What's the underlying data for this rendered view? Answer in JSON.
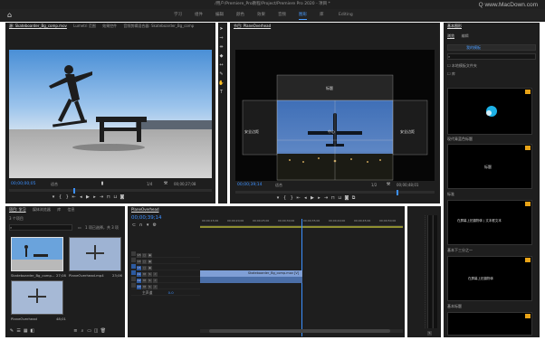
{
  "window_title": "/用户/Premiere_Pro教程/Project/Premiere Pro 2020 - 项目 *",
  "watermark": "Q www.MacDown.com",
  "menu": [
    "学习",
    "组件",
    "编辑",
    "颜色",
    "效果",
    "音频",
    "图形",
    "库",
    "Editing"
  ],
  "menu_active_index": 6,
  "source_tabs": [
    "源: Skateboarder_Bg_comp.mov",
    "Lumetri 范围",
    "效果控件",
    "音频剪辑混合器: Skateboarder_Bg_comp"
  ],
  "source_timecode_left": "00;00;00;05",
  "source_fit": "适合",
  "source_ratio": "1/4",
  "source_timecode_right": "00;00;27;08",
  "program_tab": "节目: PlaneOverhead",
  "program_timecode_left": "00;00;39;14",
  "program_fit": "适合",
  "program_ratio": "1/2",
  "program_timecode_right": "00;00;48;01",
  "overlay_labels": [
    "标题",
    "中心",
    "安全边距",
    "安全边距"
  ],
  "project_tabs": [
    "项目: 学习",
    "媒体浏览器",
    "库",
    "信息"
  ],
  "project_count": "3 个项目",
  "bin_search_count": "1 项已选择，共 3 项",
  "bin_items": [
    {
      "name": "Skateboarder_Bg_comp...",
      "dur": "27;08"
    },
    {
      "name": "PlaneOverhead.mp4",
      "dur": "23;06"
    },
    {
      "name": "PlaneOverhead",
      "dur": "48;01"
    }
  ],
  "timeline_tab": "PlaneOverhead",
  "timeline_timecode": "00;00;39;14",
  "ruler_ticks": [
    "00;00;15;00",
    "00;00;20;00",
    "00;00;25;00",
    "00;00;30;00",
    "00;00;35;00",
    "00;00;40;00",
    "00;00;45;00",
    "00;00;50;00"
  ],
  "tracks": [
    "V3",
    "V2",
    "V1",
    "A1",
    "A2",
    "A3",
    "主声道"
  ],
  "master_value": "0.0",
  "clip_label": "Skateboarder_Bg_comp.mov [V]",
  "eg_title": "基本图形",
  "eg_tabs": [
    "浏览",
    "编辑"
  ],
  "eg_dropdown": "我的模板",
  "eg_checkbox_local": "本地模板文件夹",
  "eg_checkbox_other": "库",
  "eg_tiles": [
    "现代青蓝色标题",
    "标准",
    "在屏幕上拍摄物体",
    "基本下三分之一",
    "在屏幕上拍摄物体",
    "基本标题"
  ],
  "eg_tile_text": [
    "",
    "标题",
    "在屏幕上拍摄物体 | 文本框文本",
    "在屏幕上拍摄物体"
  ]
}
